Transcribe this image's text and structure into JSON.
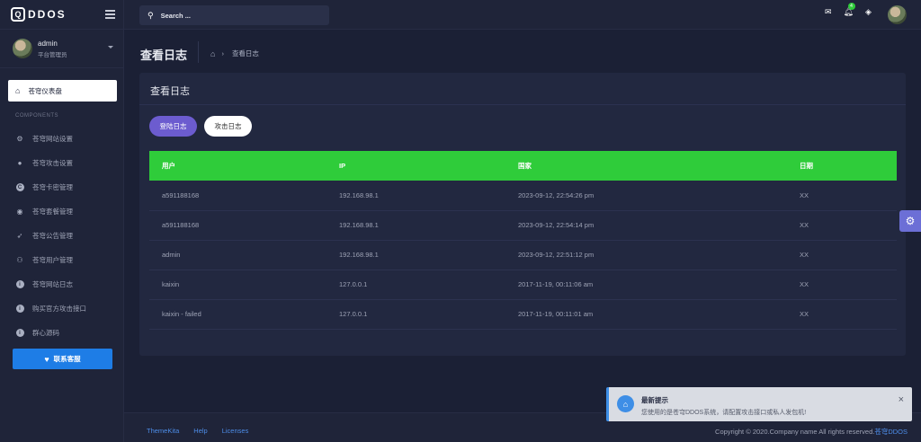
{
  "brand": {
    "logo_letter": "Q",
    "name": "DDOS"
  },
  "user": {
    "name": "admin",
    "role": "平台管理员"
  },
  "nav": {
    "active": {
      "label": "苍穹仪表盘",
      "icon": "home-icon"
    },
    "heading": "COMPONENTS",
    "items": [
      {
        "label": "苍穹网站设置",
        "icon": "gears-icon"
      },
      {
        "label": "苍穹攻击设置",
        "icon": "bomb-icon"
      },
      {
        "label": "苍穹卡密管理",
        "icon": "copyright-icon"
      },
      {
        "label": "苍穹套餐管理",
        "icon": "user-secret-icon"
      },
      {
        "label": "苍穹公告管理",
        "icon": "rocket-icon"
      },
      {
        "label": "苍穹用户管理",
        "icon": "users-icon"
      },
      {
        "label": "苍穹网站日志",
        "icon": "info-icon"
      },
      {
        "label": "购买官方攻击接口",
        "icon": "info-icon"
      },
      {
        "label": "群心源码",
        "icon": "info-icon"
      }
    ],
    "contact_label": "联系客服"
  },
  "topbar": {
    "search_placeholder": "Search ...",
    "notification_count": "4"
  },
  "header": {
    "title": "查看日志",
    "crumb": "查看日志"
  },
  "card": {
    "title": "查看日志",
    "tabs": [
      {
        "label": "登陆日志",
        "active": true
      },
      {
        "label": "攻击日志",
        "active": false
      }
    ],
    "columns": [
      "用户",
      "IP",
      "国家",
      "日期"
    ],
    "rows": [
      [
        "a591188168",
        "192.168.98.1",
        "2023-09-12, 22:54:26 pm",
        "XX"
      ],
      [
        "a591188168",
        "192.168.98.1",
        "2023-09-12, 22:54:14 pm",
        "XX"
      ],
      [
        "admin",
        "192.168.98.1",
        "2023-09-12, 22:51:12 pm",
        "XX"
      ],
      [
        "kaixin",
        "127.0.0.1",
        "2017-11-19, 00:11:06 am",
        "XX"
      ],
      [
        "kaixin - failed",
        "127.0.0.1",
        "2017-11-19, 00:11:01 am",
        "XX"
      ]
    ]
  },
  "footer": {
    "links": [
      "ThemeKita",
      "Help",
      "Licenses"
    ],
    "copyright": "Copyright © 2020.Company name All rights reserved.",
    "copyright_link": "苍穹DDOS"
  },
  "toast": {
    "title": "最新提示",
    "message": "您使用的是苍穹DDOS系统，请配置攻击接口或私人发包机!"
  },
  "colors": {
    "accent_green": "#2fcc3a",
    "accent_purple": "#6c5ccf",
    "accent_blue": "#1e7de6"
  }
}
